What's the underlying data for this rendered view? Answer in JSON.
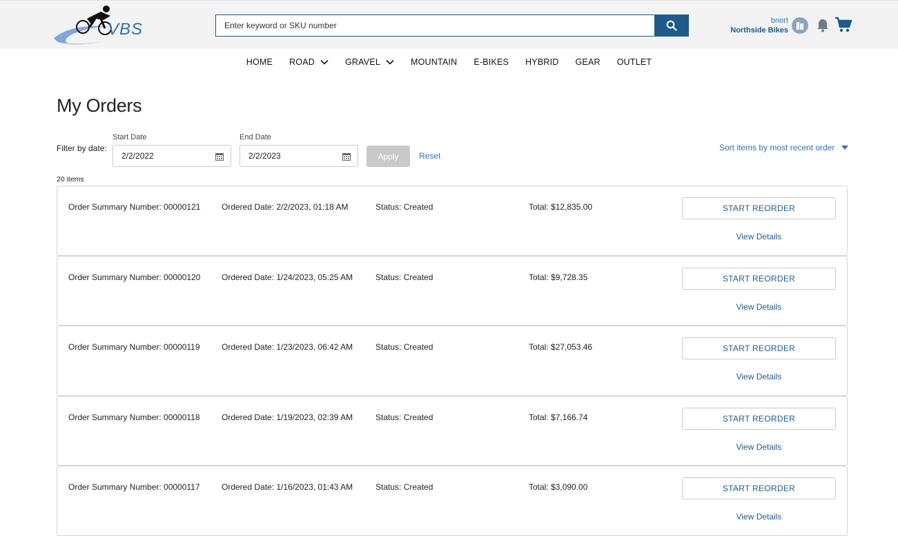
{
  "header": {
    "logo_text": "VBS",
    "search_placeholder": "Enter keyword or SKU number",
    "user_name": "bnort",
    "company_name": "Northside Bikes"
  },
  "nav": {
    "items": [
      {
        "label": "HOME",
        "has_dropdown": false
      },
      {
        "label": "ROAD",
        "has_dropdown": true
      },
      {
        "label": "GRAVEL",
        "has_dropdown": true
      },
      {
        "label": "MOUNTAIN",
        "has_dropdown": false
      },
      {
        "label": "E-BIKES",
        "has_dropdown": false
      },
      {
        "label": "HYBRID",
        "has_dropdown": false
      },
      {
        "label": "GEAR",
        "has_dropdown": false
      },
      {
        "label": "OUTLET",
        "has_dropdown": false
      }
    ]
  },
  "page": {
    "title": "My Orders",
    "filter_label": "Filter by date:",
    "start_date_label": "Start Date",
    "start_date_value": "2/2/2022",
    "end_date_label": "End Date",
    "end_date_value": "2/2/2023",
    "apply_label": "Apply",
    "reset_label": "Reset",
    "sort_label": "Sort items by most recent order",
    "item_count": "20 items"
  },
  "orders": [
    {
      "number": "Order Summary Number: 00000121",
      "date": "Ordered Date: 2/2/2023, 01:18 AM",
      "status": "Status: Created",
      "total": "Total: $12,835.00",
      "reorder_label": "START REORDER",
      "details_label": "View Details"
    },
    {
      "number": "Order Summary Number: 00000120",
      "date": "Ordered Date: 1/24/2023, 05:25 AM",
      "status": "Status: Created",
      "total": "Total: $9,728.35",
      "reorder_label": "START REORDER",
      "details_label": "View Details"
    },
    {
      "number": "Order Summary Number: 00000119",
      "date": "Ordered Date: 1/23/2023, 06:42 AM",
      "status": "Status: Created",
      "total": "Total: $27,053.46",
      "reorder_label": "START REORDER",
      "details_label": "View Details"
    },
    {
      "number": "Order Summary Number: 00000118",
      "date": "Ordered Date: 1/19/2023, 02:39 AM",
      "status": "Status: Created",
      "total": "Total: $7,166.74",
      "reorder_label": "START REORDER",
      "details_label": "View Details"
    },
    {
      "number": "Order Summary Number: 00000117",
      "date": "Ordered Date: 1/16/2023, 01:43 AM",
      "status": "Status: Created",
      "total": "Total: $3,090.00",
      "reorder_label": "START REORDER",
      "details_label": "View Details"
    }
  ],
  "icons": {
    "search": "search-icon",
    "account": "building-icon",
    "notifications": "bell-icon",
    "cart": "cart-icon",
    "calendar": "calendar-icon",
    "dropdown": "chevron-down-icon",
    "sort_dropdown": "caret-down-icon"
  },
  "colors": {
    "brand_blue": "#1f5a8a",
    "link_blue": "#2f6fb6",
    "header_bg": "#f3f3f3",
    "disabled_button": "#c9c9c9"
  }
}
